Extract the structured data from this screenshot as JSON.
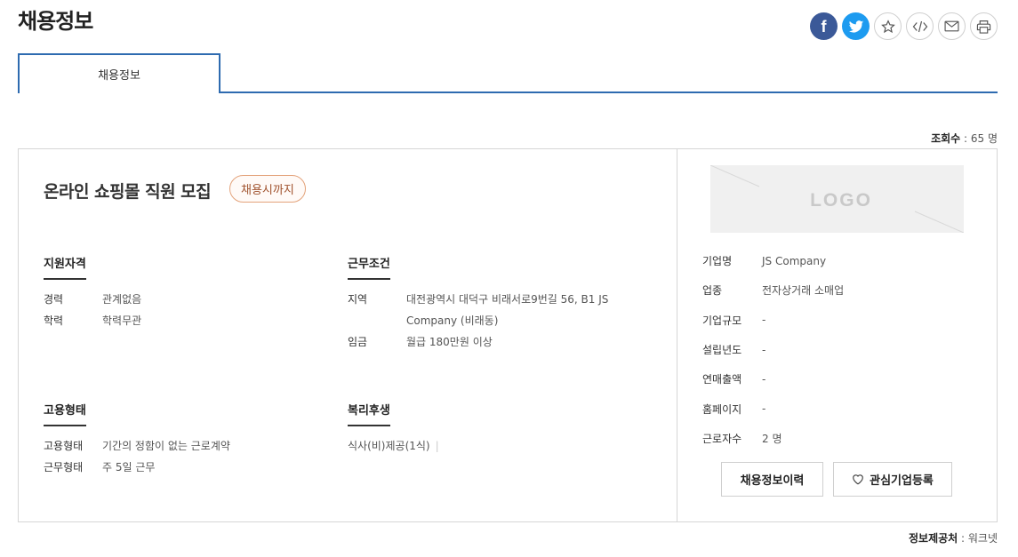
{
  "page": {
    "title": "채용정보"
  },
  "share": {
    "icons": [
      "facebook-icon",
      "twitter-icon",
      "star-icon",
      "code-embed-icon",
      "mail-icon",
      "print-icon"
    ],
    "colors": {
      "facebook": "#3b5998",
      "twitter": "#1d9bf0"
    }
  },
  "tabs": [
    {
      "label": "채용정보",
      "active": true
    }
  ],
  "views": {
    "label": "조회수",
    "value": "65 명"
  },
  "job": {
    "title": "온라인 쇼핑몰 직원 모집",
    "deadline_badge": "채용시까지"
  },
  "qualifications": {
    "heading": "지원자격",
    "rows": [
      {
        "key": "경력",
        "value": "관계없음"
      },
      {
        "key": "학력",
        "value": "학력무관"
      }
    ]
  },
  "conditions": {
    "heading": "근무조건",
    "rows": [
      {
        "key": "지역",
        "value_line1": "대전광역시 대덕구 비래서로9번길 56, B1 JS",
        "value_line2": "Company (비래동)"
      },
      {
        "key": "임금",
        "value": "월급 180만원 이상"
      }
    ]
  },
  "employment": {
    "heading": "고용형태",
    "rows": [
      {
        "key": "고용형태",
        "value": "기간의 정함이 없는 근로계약"
      },
      {
        "key": "근무형태",
        "value": "주 5일 근무"
      }
    ]
  },
  "benefits": {
    "heading": "복리후생",
    "items": [
      "식사(비)제공(1식)"
    ]
  },
  "company": {
    "logo_text": "LOGO",
    "rows": [
      {
        "key": "기업명",
        "value": "JS Company"
      },
      {
        "key": "업종",
        "value": "전자상거래 소매업"
      },
      {
        "key": "기업규모",
        "value": "-"
      },
      {
        "key": "설립년도",
        "value": "-"
      },
      {
        "key": "연매출액",
        "value": "-"
      },
      {
        "key": "홈페이지",
        "value": "-"
      },
      {
        "key": "근로자수",
        "value": "2 명"
      }
    ]
  },
  "buttons": {
    "history": "채용정보이력",
    "favorite": "관심기업등록"
  },
  "source": {
    "label": "정보제공처",
    "value": "워크넷"
  }
}
